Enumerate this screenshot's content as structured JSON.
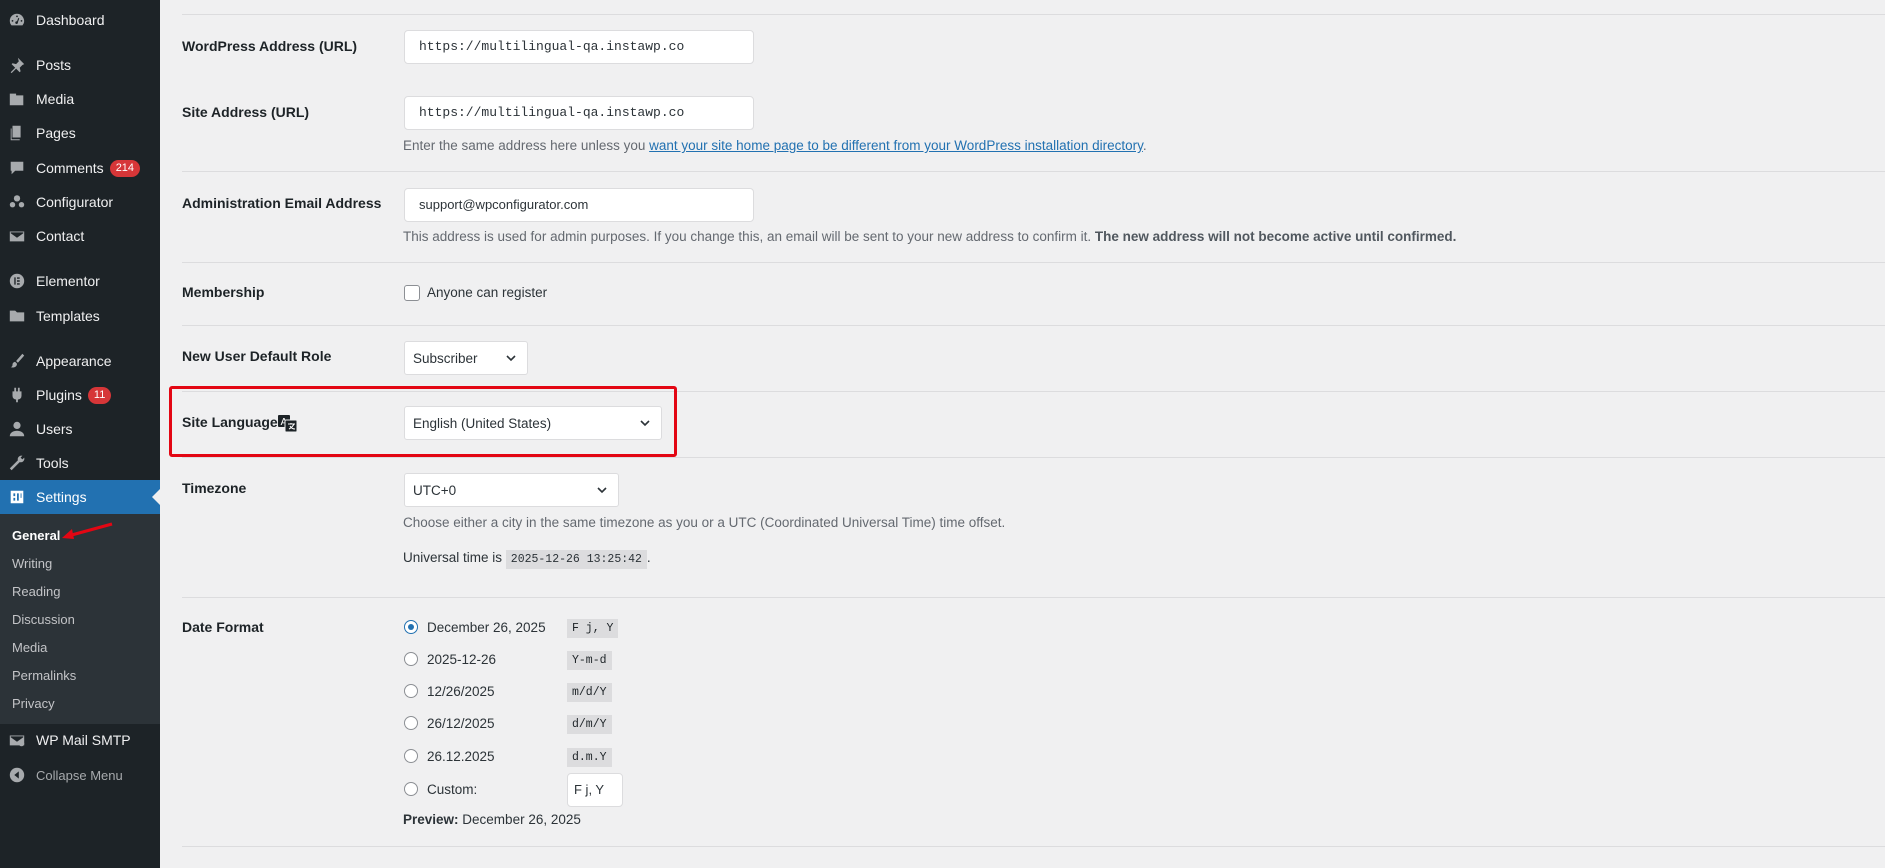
{
  "sidebar": {
    "items": [
      {
        "label": "Dashboard",
        "icon": "dashboard-icon"
      },
      {
        "label": "Posts",
        "icon": "pin-icon"
      },
      {
        "label": "Media",
        "icon": "media-icon"
      },
      {
        "label": "Pages",
        "icon": "pages-icon"
      },
      {
        "label": "Comments",
        "icon": "comment-icon",
        "badge": "214"
      },
      {
        "label": "Configurator",
        "icon": "users-group-icon"
      },
      {
        "label": "Contact",
        "icon": "mail-icon"
      },
      {
        "label": "Elementor",
        "icon": "elementor-icon"
      },
      {
        "label": "Templates",
        "icon": "folder-icon"
      },
      {
        "label": "Appearance",
        "icon": "brush-icon"
      },
      {
        "label": "Plugins",
        "icon": "plugin-icon",
        "badge": "11"
      },
      {
        "label": "Users",
        "icon": "user-icon"
      },
      {
        "label": "Tools",
        "icon": "wrench-icon"
      },
      {
        "label": "Settings",
        "icon": "settings-icon",
        "active": true
      },
      {
        "label": "WP Mail SMTP",
        "icon": "mail-smtp-icon"
      },
      {
        "label": "Collapse Menu",
        "icon": "collapse-icon"
      }
    ],
    "submenu": [
      "General",
      "Writing",
      "Reading",
      "Discussion",
      "Media",
      "Permalinks",
      "Privacy"
    ]
  },
  "form": {
    "wp_address": {
      "label": "WordPress Address (URL)",
      "value": "https://multilingual-qa.instawp.co"
    },
    "site_address": {
      "label": "Site Address (URL)",
      "value": "https://multilingual-qa.instawp.co",
      "desc_before": "Enter the same address here unless you ",
      "desc_link": "want your site home page to be different from your WordPress installation directory",
      "desc_after": "."
    },
    "admin_email": {
      "label": "Administration Email Address",
      "value": "support@wpconfigurator.com",
      "desc": "This address is used for admin purposes. If you change this, an email will be sent to your new address to confirm it. ",
      "desc_bold": "The new address will not become active until confirmed."
    },
    "membership": {
      "label": "Membership",
      "option": "Anyone can register",
      "checked": false
    },
    "default_role": {
      "label": "New User Default Role",
      "value": "Subscriber"
    },
    "site_language": {
      "label": "Site Language",
      "icon": "translate-icon",
      "value": "English (United States)"
    },
    "timezone": {
      "label": "Timezone",
      "value": "UTC+0",
      "desc": "Choose either a city in the same timezone as you or a UTC (Coordinated Universal Time) time offset.",
      "universal_label": "Universal time is",
      "universal_value": "2025-12-26 13:25:42",
      "universal_after": "."
    },
    "date_format": {
      "label": "Date Format",
      "options": [
        {
          "label": "December 26, 2025",
          "code": "F j, Y",
          "checked": true
        },
        {
          "label": "2025-12-26",
          "code": "Y-m-d",
          "checked": false
        },
        {
          "label": "12/26/2025",
          "code": "m/d/Y",
          "checked": false
        },
        {
          "label": "26/12/2025",
          "code": "d/m/Y",
          "checked": false
        },
        {
          "label": "26.12.2025",
          "code": "d.m.Y",
          "checked": false
        }
      ],
      "custom_label": "Custom:",
      "custom_value": "F j, Y",
      "preview_label": "Preview:",
      "preview_value": "December 26, 2025"
    }
  },
  "colors": {
    "accent": "#2271b1",
    "highlight": "#e30613",
    "badge": "#d63638",
    "sidebar": "#1d2327"
  }
}
